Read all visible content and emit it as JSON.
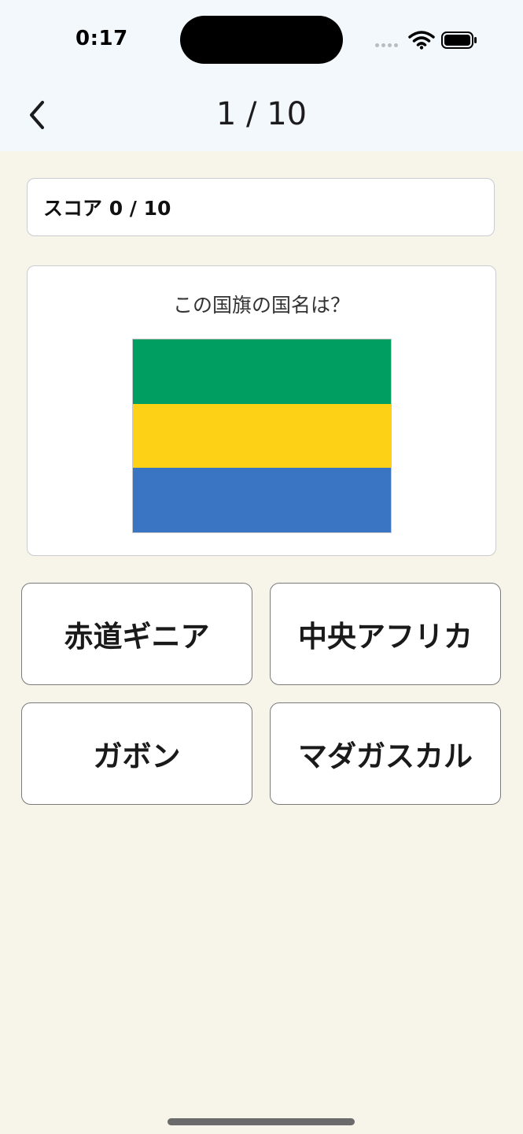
{
  "status_bar": {
    "time": "0:17",
    "icons": [
      "signal-dots-icon",
      "wifi-icon",
      "battery-icon"
    ]
  },
  "nav": {
    "back_icon": "chevron-left-icon",
    "title": "1 / 10"
  },
  "score": {
    "label": "スコア 0 / 10"
  },
  "question": {
    "prompt": "この国旗の国名は？",
    "flag_colors": [
      "#009e60",
      "#fcd116",
      "#3a75c4"
    ]
  },
  "answers": [
    {
      "label": "赤道ギニア"
    },
    {
      "label": "中央アフリカ"
    },
    {
      "label": "ガボン"
    },
    {
      "label": "マダガスカル"
    }
  ],
  "colors": {
    "header_bg": "#f3f8fc",
    "page_bg": "#f7f4e9",
    "card_bg": "#ffffff"
  }
}
